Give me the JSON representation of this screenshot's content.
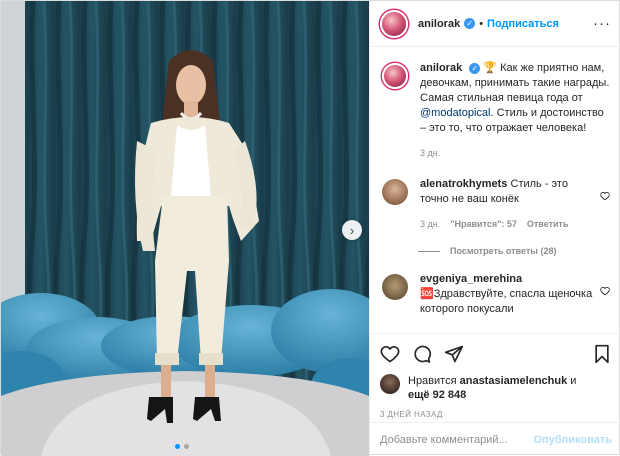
{
  "post": {
    "username": "anilorak",
    "separator": "•",
    "follow_label": "Подписаться",
    "more_icon": "ellipsis-icon",
    "carousel": {
      "current_slide": 1,
      "total_slides": 2
    }
  },
  "caption": {
    "username": "anilorak",
    "emoji": "🏆",
    "text_before": "Как же приятно нам, девочкам, принимать такие награды. Самая стильная певица года от ",
    "mention": "@modatopical",
    "text_after": ". Стиль и достоинство – это то, что отражает человека!",
    "time": "3 дн."
  },
  "comments": [
    {
      "username": "alenatrokhymets",
      "text": "Стиль - это точно не ваш конёк",
      "time": "3 дн.",
      "likes": "\"Нравится\": 57",
      "reply_label": "Ответить",
      "view_replies": "Посмотреть ответы (28)"
    },
    {
      "username": "evgeniya_merehina",
      "emoji": "🆘",
      "text": "Здравствуйте, спасла щеночка которого покусали"
    }
  ],
  "actions": {
    "liked_by_prefix": "Нравится",
    "liked_by_user": "anastasiamelenchuk",
    "and_label": "и",
    "others_label": "ещё 92 848",
    "date": "3 ДНЕЙ НАЗАД"
  },
  "comment_box": {
    "placeholder": "Добавьте комментарий...",
    "publish_label": "Опубликовать"
  },
  "colors": {
    "accent": "#0095f6",
    "verified": "#3897f0",
    "curtain": "#245565",
    "feathers": "#3b8fb5"
  }
}
